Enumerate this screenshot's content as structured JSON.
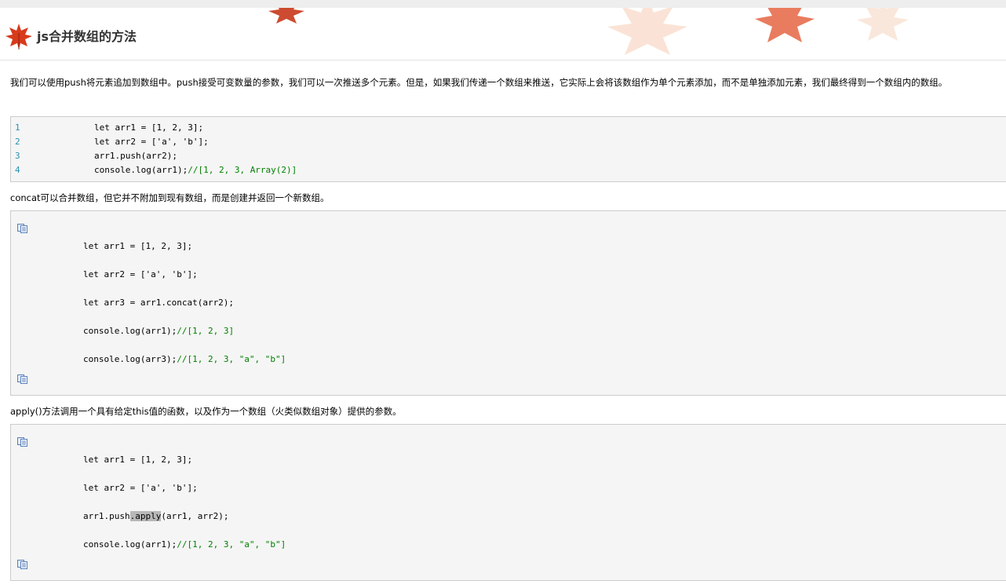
{
  "header": {
    "title": "js合并数组的方法"
  },
  "intro": "我们可以使用push将元素追加到数组中。push接受可变数量的参数，我们可以一次推送多个元素。但是，如果我们传递一个数组来推送，它实际上会将该数组作为单个元素添加，而不是单独添加元素，我们最终得到一个数组内的数组。",
  "block1": {
    "line_numbers": [
      "1",
      "2",
      "3",
      "4"
    ],
    "lines": [
      {
        "code": "let arr1 = [1, 2, 3];",
        "comment": ""
      },
      {
        "code": "let arr2 = ['a', 'b'];",
        "comment": ""
      },
      {
        "code": "arr1.push(arr2);",
        "comment": ""
      },
      {
        "code": "console.log(arr1);",
        "comment": "//[1, 2, 3, Array(2)]"
      }
    ]
  },
  "concat_text": "concat可以合并数组，但它并不附加到现有数组，而是创建并返回一个新数组。",
  "block2": {
    "lines": [
      {
        "code": "let arr1 = [1, 2, 3];",
        "comment": ""
      },
      {
        "code": "let arr2 = ['a', 'b'];",
        "comment": ""
      },
      {
        "code": "let arr3 = arr1.concat(arr2);",
        "comment": ""
      },
      {
        "code": "console.log(arr1);",
        "comment": "//[1, 2, 3]"
      },
      {
        "code": "console.log(arr3);",
        "comment": "//[1, 2, 3, \"a\", \"b\"]"
      }
    ]
  },
  "apply_text": "apply()方法调用一个具有给定this值的函数，以及作为一个数组（火类似数组对象）提供的参数。",
  "block3": {
    "lines": [
      {
        "code": "let arr1 = [1, 2, 3];",
        "comment": ""
      },
      {
        "code": "let arr2 = ['a', 'b'];",
        "comment": ""
      },
      {
        "pre": "arr1.push",
        "highlight": ".apply",
        "post": "(arr1, arr2);"
      },
      {
        "code": "console.log(arr1);",
        "comment": "//[1, 2, 3, \"a\", \"b\"]"
      }
    ]
  },
  "icons": {
    "title_icon": "maple-leaf-icon",
    "copy_icon": "copy-code-icon"
  },
  "colors": {
    "comment": "#008000",
    "line_number": "#2b91af",
    "code_bg": "#f5f5f5"
  }
}
